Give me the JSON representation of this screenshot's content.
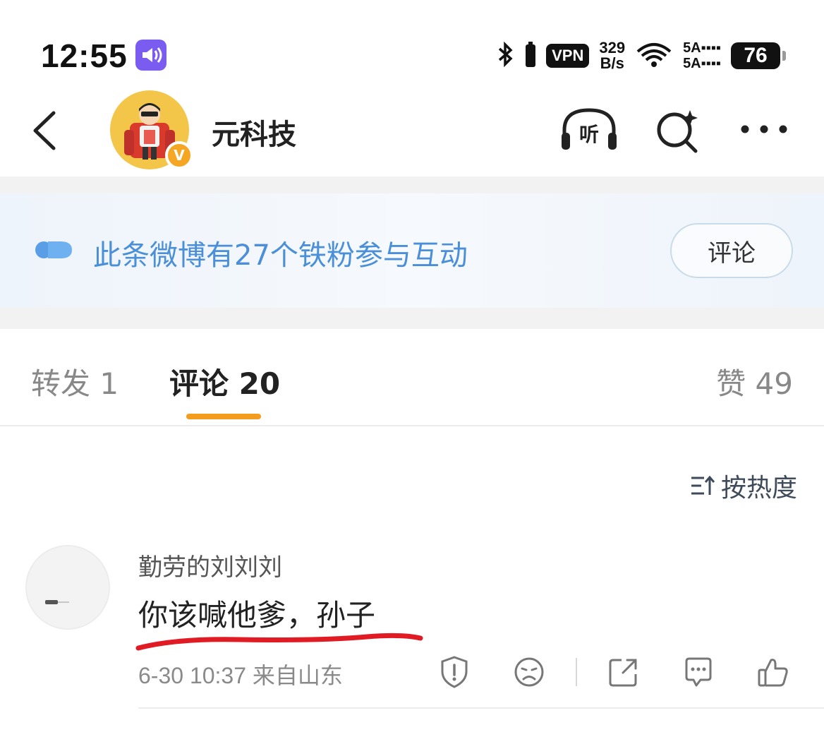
{
  "status_bar": {
    "time": "12:55",
    "vpn": "VPN",
    "net_speed_top": "329",
    "net_speed_bottom": "B/s",
    "sim1": "5A",
    "sim2": "5A",
    "battery": "76"
  },
  "header": {
    "account_name": "元科技",
    "verify_mark": "V"
  },
  "banner": {
    "text": "此条微博有27个铁粉参与互动",
    "button_label": "评论"
  },
  "tabs": {
    "repost": "转发 1",
    "comments": "评论 20",
    "likes": "赞 49"
  },
  "sort": {
    "label": "按热度"
  },
  "comment": {
    "username": "勤劳的刘刘刘",
    "text": "你该喊他爹，孙子",
    "meta": "6-30 10:37 来自山东"
  },
  "colors": {
    "accent_orange": "#f39c1e",
    "banner_blue": "#4a8fd8",
    "verify_orange": "#f5a623",
    "annotation_red": "#e01b24"
  },
  "icons": {
    "header": [
      "back-arrow-icon",
      "headphones-listen-icon",
      "sparkle-search-icon",
      "more-dots-icon"
    ],
    "comment_actions": [
      "report-icon",
      "dislike-face-icon",
      "share-icon",
      "reply-icon",
      "like-icon"
    ]
  }
}
